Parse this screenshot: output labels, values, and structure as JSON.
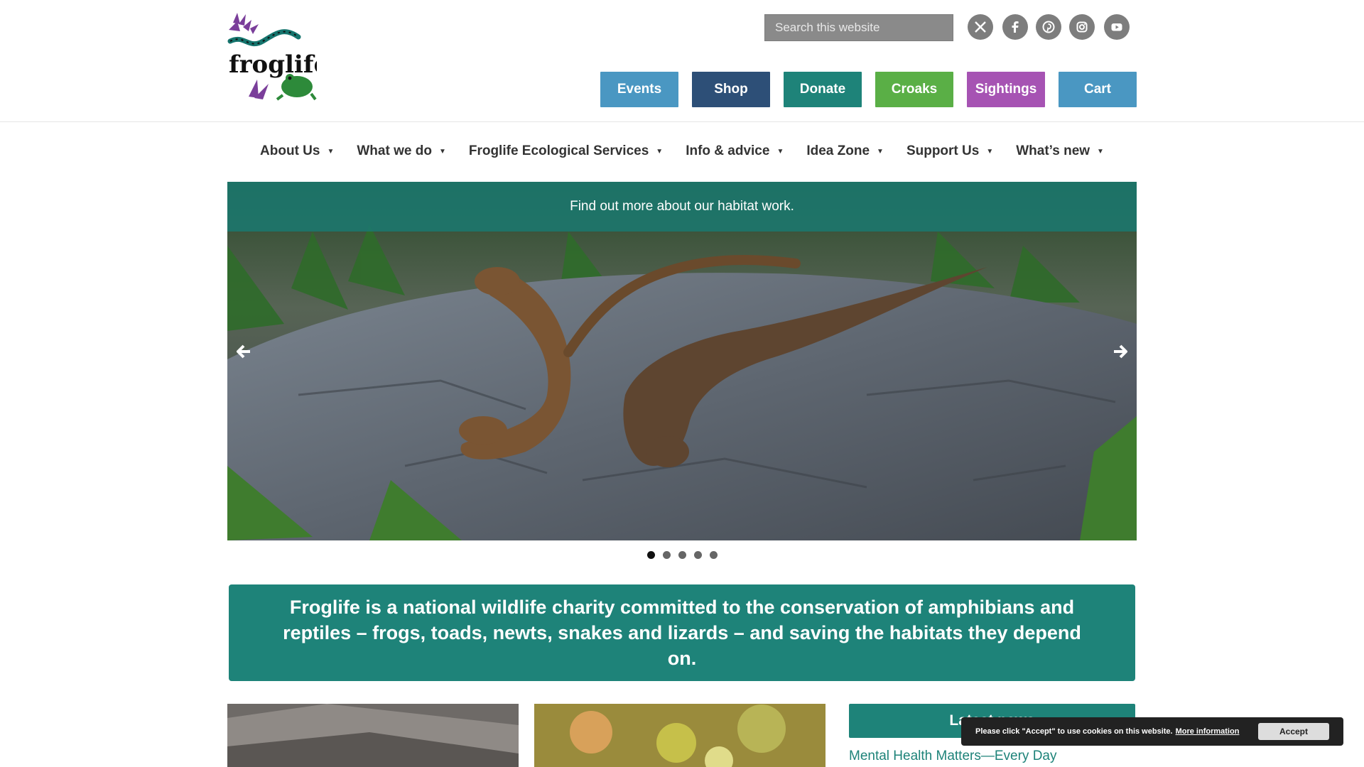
{
  "header": {
    "logo_text": "froglife",
    "search_placeholder": "Search this website",
    "social": [
      "x-icon",
      "facebook-icon",
      "pinterest-icon",
      "instagram-icon",
      "youtube-icon"
    ],
    "buttons": [
      {
        "label": "Events",
        "color": "#4a97c2"
      },
      {
        "label": "Shop",
        "color": "#2d4f77"
      },
      {
        "label": "Donate",
        "color": "#1e8379"
      },
      {
        "label": "Croaks",
        "color": "#5aaf46"
      },
      {
        "label": "Sightings",
        "color": "#a653b3"
      },
      {
        "label": "Cart",
        "color": "#4a97c2"
      }
    ]
  },
  "nav": {
    "items": [
      {
        "label": "About Us"
      },
      {
        "label": "What we do"
      },
      {
        "label": "Froglife Ecological Services"
      },
      {
        "label": "Info & advice"
      },
      {
        "label": "Idea Zone"
      },
      {
        "label": "Support Us"
      },
      {
        "label": "What’s new"
      }
    ]
  },
  "slider": {
    "caption": "Find out more about our habitat work.",
    "slide_count": 5,
    "active_index": 0
  },
  "mission": {
    "text": "Froglife is a national wildlife charity committed to the conservation of amphibians and reptiles – frogs, toads, newts, snakes and lizards – and saving the habitats they depend on."
  },
  "news": {
    "heading": "Latest news",
    "first_item": "Mental Health Matters—Every Day"
  },
  "cookie": {
    "message": "Please click \"Accept\" to use cookies on this website.",
    "link": "More information",
    "accept": "Accept"
  },
  "colors": {
    "teal": "#1e8379",
    "grey_social": "#7d7d7d"
  }
}
